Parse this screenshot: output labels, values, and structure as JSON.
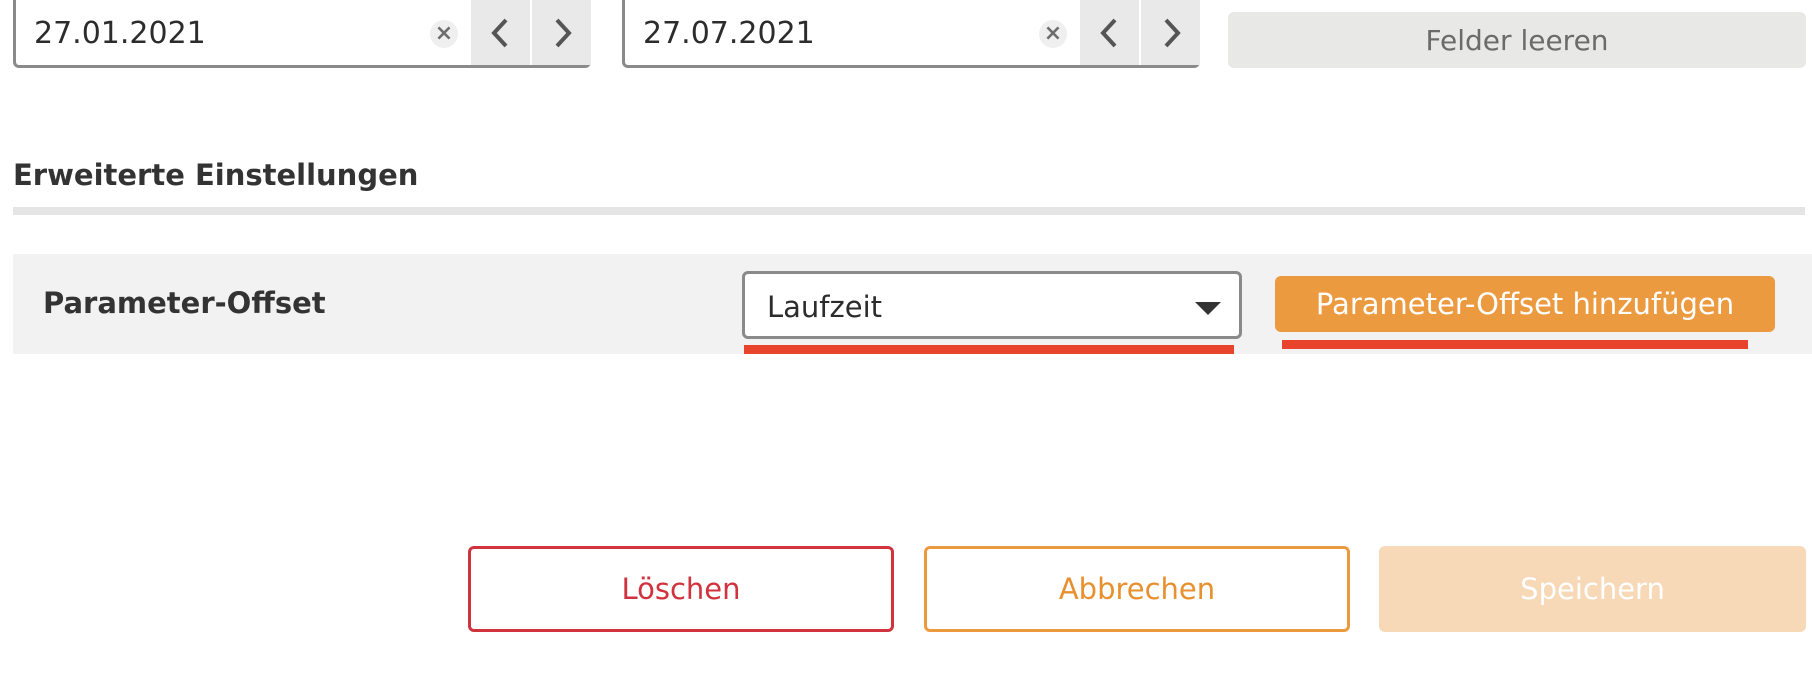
{
  "date_range": {
    "from": {
      "value": "27.01.2021",
      "clear_icon": "×"
    },
    "to": {
      "value": "27.07.2021",
      "clear_icon": "×"
    },
    "clear_fields_label": "Felder leeren"
  },
  "advanced": {
    "title": "Erweiterte Einstellungen",
    "parameter_offset": {
      "label": "Parameter-Offset",
      "selected": "Laufzeit",
      "add_button_label": "Parameter-Offset hinzufügen"
    }
  },
  "footer": {
    "delete_label": "Löschen",
    "cancel_label": "Abbrechen",
    "save_label": "Speichern"
  },
  "colors": {
    "accent_orange": "#ec9a40",
    "danger_red": "#d0333d",
    "highlight_underline": "#e8432c"
  }
}
